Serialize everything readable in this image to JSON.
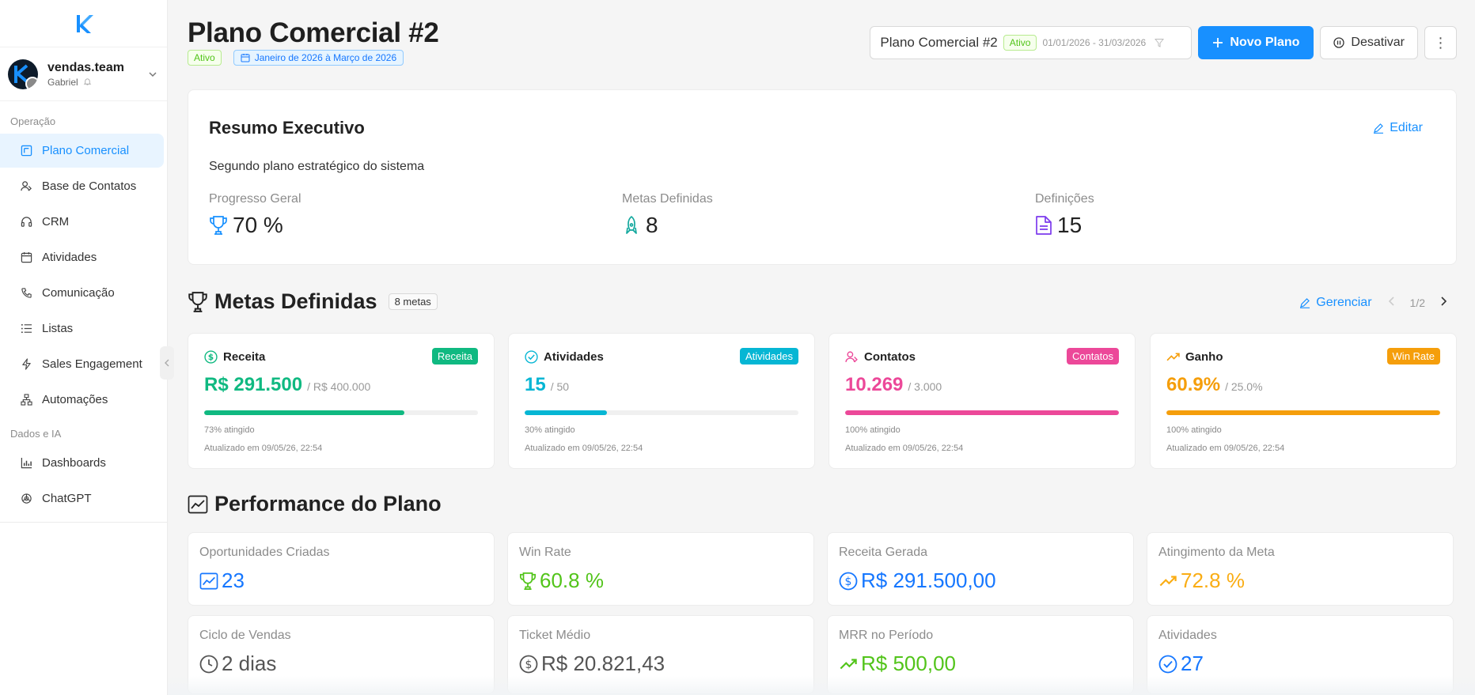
{
  "sidebar": {
    "org_name": "vendas.team",
    "user_name": "Gabriel",
    "section_ops": "Operação",
    "section_data": "Dados e IA",
    "items": [
      {
        "label": "Plano Comercial"
      },
      {
        "label": "Base de Contatos"
      },
      {
        "label": "CRM"
      },
      {
        "label": "Atividades"
      },
      {
        "label": "Comunicação"
      },
      {
        "label": "Listas"
      },
      {
        "label": "Sales Engagement"
      },
      {
        "label": "Automações"
      },
      {
        "label": "Dashboards"
      },
      {
        "label": "ChatGPT"
      }
    ]
  },
  "header": {
    "title": "Plano Comercial #2",
    "status": "Ativo",
    "period": "Janeiro de 2026 à Março de 2026",
    "select_name": "Plano Comercial #2",
    "select_status": "Ativo",
    "select_range": "01/01/2026 - 31/03/2026",
    "new_plan": "Novo Plano",
    "deactivate": "Desativar",
    "more": "⋮"
  },
  "summary": {
    "title": "Resumo Executivo",
    "edit": "Editar",
    "description": "Segundo plano estratégico do sistema",
    "progress_label": "Progresso Geral",
    "progress_value": "70 %",
    "goals_label": "Metas Definidas",
    "goals_value": "8",
    "defs_label": "Definições",
    "defs_value": "15"
  },
  "metas": {
    "title": "Metas Definidas",
    "count": "8 metas",
    "manage": "Gerenciar",
    "page": "1/2",
    "cards": [
      {
        "name": "Receita",
        "tag": "Receita",
        "value": "R$ 291.500",
        "target": "/ R$ 400.000",
        "progress": 0.73,
        "pct": "73% atingido",
        "updated": "Atualizado em 09/05/26, 22:54",
        "color": "#10b981"
      },
      {
        "name": "Atividades",
        "tag": "Atividades",
        "value": "15",
        "target": "/ 50",
        "progress": 0.3,
        "pct": "30% atingido",
        "updated": "Atualizado em 09/05/26, 22:54",
        "color": "#06b6d4"
      },
      {
        "name": "Contatos",
        "tag": "Contatos",
        "value": "10.269",
        "target": "/ 3.000",
        "progress": 1.0,
        "pct": "100% atingido",
        "updated": "Atualizado em 09/05/26, 22:54",
        "color": "#ec4899"
      },
      {
        "name": "Ganho",
        "tag": "Win Rate",
        "value": "60.9%",
        "target": "/ 25.0%",
        "progress": 1.0,
        "pct": "100% atingido",
        "updated": "Atualizado em 09/05/26, 22:54",
        "color": "#f59e0b"
      }
    ]
  },
  "performance": {
    "title": "Performance do Plano",
    "cards": [
      {
        "label": "Oportunidades Criadas",
        "value": "23",
        "color": "#1677ff"
      },
      {
        "label": "Win Rate",
        "value": "60.8 %",
        "color": "#52c41a"
      },
      {
        "label": "Receita Gerada",
        "value": "R$ 291.500,00",
        "color": "#1677ff"
      },
      {
        "label": "Atingimento da Meta",
        "value": "72.8 %",
        "color": "#faad14"
      },
      {
        "label": "Ciclo de Vendas",
        "value": "2 dias",
        "color": "#555555"
      },
      {
        "label": "Ticket Médio",
        "value": "R$ 20.821,43",
        "color": "#555555"
      },
      {
        "label": "MRR no Período",
        "value": "R$ 500,00",
        "color": "#52c41a"
      },
      {
        "label": "Atividades",
        "value": "27",
        "color": "#1677ff"
      }
    ]
  }
}
